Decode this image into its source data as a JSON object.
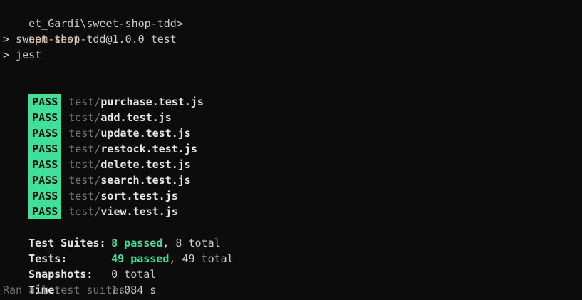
{
  "prompt": {
    "path": "et_Gardi\\sweet-shop-tdd>",
    "command": "npm test"
  },
  "npm_output": {
    "line1": "> sweet-shop-tdd@1.0.0 test",
    "line2": "> jest"
  },
  "results": [
    {
      "status": "PASS",
      "dir": "test/",
      "file": "purchase.test.js"
    },
    {
      "status": "PASS",
      "dir": "test/",
      "file": "add.test.js"
    },
    {
      "status": "PASS",
      "dir": "test/",
      "file": "update.test.js"
    },
    {
      "status": "PASS",
      "dir": "test/",
      "file": "restock.test.js"
    },
    {
      "status": "PASS",
      "dir": "test/",
      "file": "delete.test.js"
    },
    {
      "status": "PASS",
      "dir": "test/",
      "file": "search.test.js"
    },
    {
      "status": "PASS",
      "dir": "test/",
      "file": "sort.test.js"
    },
    {
      "status": "PASS",
      "dir": "test/",
      "file": "view.test.js"
    }
  ],
  "summary": {
    "suites_label": "Test Suites:",
    "suites_passed": "8 passed",
    "suites_total": ", 8 total",
    "tests_label": "Tests:",
    "tests_passed": "49 passed",
    "tests_total": ", 49 total",
    "snapshots_label": "Snapshots:",
    "snapshots_value": "0 total",
    "time_label": "Time:",
    "time_value": "1.084 s",
    "ran_all": "Ran all test suites."
  },
  "colors": {
    "background": "#0c0c0c",
    "foreground": "#cccccc",
    "command": "#f0a23c",
    "pass": "#3fe09a",
    "muted": "#767676"
  }
}
